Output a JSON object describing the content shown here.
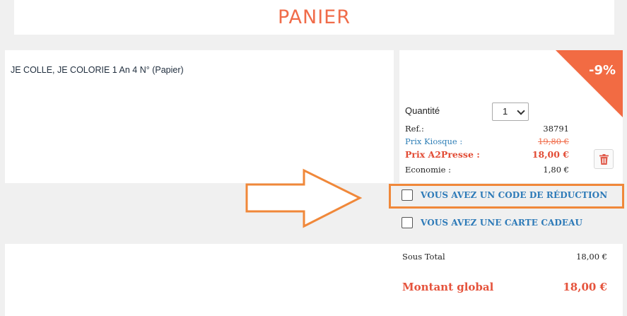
{
  "header": {
    "title": "PANIER"
  },
  "product": {
    "name": "JE COLLE, JE COLORIE 1 An 4 N° (Papier)",
    "discount_badge": "-9%",
    "quantity_label": "Quantité",
    "quantity_value": "1",
    "ref_label": "Ref.:",
    "ref_value": "38791",
    "kiosque_label": "Prix Kiosque :",
    "kiosque_value": "19,80 €",
    "a2presse_label": "Prix A2Presse :",
    "a2presse_value": "18,00 €",
    "economie_label": "Economie :",
    "economie_value": "1,80 €"
  },
  "options": {
    "promo_code_label": "VOUS AVEZ UN CODE DE RÉDUCTION",
    "gift_card_label": "VOUS AVEZ UNE CARTE CADEAU"
  },
  "totals": {
    "subtotal_label": "Sous Total",
    "subtotal_value": "18,00 €",
    "global_label": "Montant global",
    "global_value": "18,00 €"
  },
  "colors": {
    "accent": "#f06c4a",
    "link_blue": "#2d7ab8",
    "highlight_orange": "#f0883a",
    "trash_red": "#e05a4a"
  }
}
